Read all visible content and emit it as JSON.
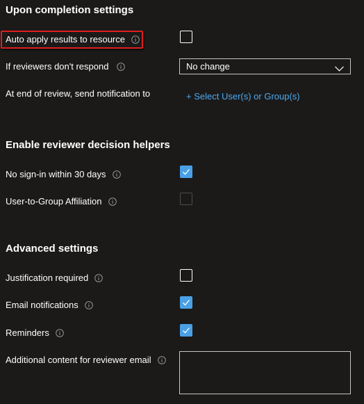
{
  "sections": {
    "completion": {
      "title": "Upon completion settings",
      "auto_apply_label": "Auto apply results to resource",
      "no_response_label": "If reviewers don't respond",
      "no_response_value": "No change",
      "notify_label": "At end of review, send notification to",
      "select_link": "+ Select User(s) or Group(s)"
    },
    "helpers": {
      "title": "Enable reviewer decision helpers",
      "no_signin_label": "No sign-in within 30 days",
      "affiliation_label": "User-to-Group Affiliation"
    },
    "advanced": {
      "title": "Advanced settings",
      "justification_label": "Justification required",
      "email_label": "Email notifications",
      "reminders_label": "Reminders",
      "additional_label": "Additional content for reviewer email",
      "additional_value": ""
    }
  },
  "checkbox_states": {
    "auto_apply": false,
    "no_signin": true,
    "affiliation": false,
    "affiliation_disabled": true,
    "justification": false,
    "email": true,
    "reminders": true
  },
  "colors": {
    "background": "#1b1a19",
    "accent": "#4aa0e6",
    "link": "#4ca9ef",
    "highlight": "#e01e1e"
  },
  "icons": {
    "info": "info-icon",
    "chevron": "chevron-down-icon",
    "check": "checkmark-icon"
  }
}
